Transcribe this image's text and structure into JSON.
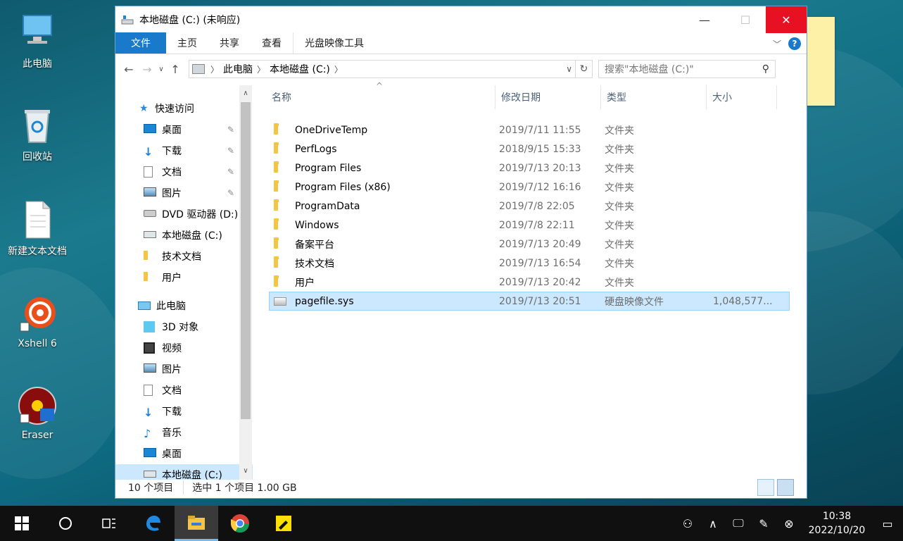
{
  "desktop": {
    "icons": [
      {
        "label": "此电脑",
        "icon": "computer-icon"
      },
      {
        "label": "回收站",
        "icon": "recycle-bin-icon"
      },
      {
        "label": "新建文本文档",
        "icon": "text-document-icon"
      },
      {
        "label": "Xshell 6",
        "icon": "xshell-icon"
      },
      {
        "label": "Eraser",
        "icon": "eraser-icon"
      }
    ]
  },
  "window": {
    "title": "本地磁盘 (C:) (未响应)",
    "ribbon_tabs": [
      "文件",
      "主页",
      "共享",
      "查看",
      "光盘映像工具"
    ],
    "breadcrumb": [
      "此电脑",
      "本地磁盘 (C:)"
    ],
    "search_placeholder": "搜索\"本地磁盘 (C:)\"",
    "nav": {
      "quick_access": "快速访问",
      "quick_items": [
        {
          "label": "桌面",
          "icon": "desktop-icon",
          "pinned": true
        },
        {
          "label": "下载",
          "icon": "download-icon",
          "pinned": true
        },
        {
          "label": "文档",
          "icon": "document-icon",
          "pinned": true
        },
        {
          "label": "图片",
          "icon": "picture-icon",
          "pinned": true
        },
        {
          "label": "DVD 驱动器 (D:)",
          "icon": "dvd-drive-icon",
          "pinned": false
        },
        {
          "label": "本地磁盘 (C:)",
          "icon": "local-disk-icon",
          "pinned": false
        },
        {
          "label": "技术文档",
          "icon": "folder-icon",
          "pinned": false
        },
        {
          "label": "用户",
          "icon": "folder-icon",
          "pinned": false
        }
      ],
      "this_pc": "此电脑",
      "pc_items": [
        {
          "label": "3D 对象",
          "icon": "3d-objects-icon"
        },
        {
          "label": "视频",
          "icon": "video-icon"
        },
        {
          "label": "图片",
          "icon": "picture-icon"
        },
        {
          "label": "文档",
          "icon": "document-icon"
        },
        {
          "label": "下载",
          "icon": "download-icon"
        },
        {
          "label": "音乐",
          "icon": "music-icon"
        },
        {
          "label": "桌面",
          "icon": "desktop-icon"
        },
        {
          "label": "本地磁盘 (C:)",
          "icon": "local-disk-icon"
        }
      ]
    },
    "columns": [
      "名称",
      "修改日期",
      "类型",
      "大小"
    ],
    "files": [
      {
        "name": "OneDriveTemp",
        "date": "2019/7/11 11:55",
        "type": "文件夹",
        "size": "",
        "kind": "folder"
      },
      {
        "name": "PerfLogs",
        "date": "2018/9/15 15:33",
        "type": "文件夹",
        "size": "",
        "kind": "folder"
      },
      {
        "name": "Program Files",
        "date": "2019/7/13 20:13",
        "type": "文件夹",
        "size": "",
        "kind": "folder"
      },
      {
        "name": "Program Files (x86)",
        "date": "2019/7/12 16:16",
        "type": "文件夹",
        "size": "",
        "kind": "folder"
      },
      {
        "name": "ProgramData",
        "date": "2019/7/8 22:05",
        "type": "文件夹",
        "size": "",
        "kind": "folder-narrow"
      },
      {
        "name": "Windows",
        "date": "2019/7/8 22:11",
        "type": "文件夹",
        "size": "",
        "kind": "folder"
      },
      {
        "name": "备案平台",
        "date": "2019/7/13 20:49",
        "type": "文件夹",
        "size": "",
        "kind": "folder"
      },
      {
        "name": "技术文档",
        "date": "2019/7/13 16:54",
        "type": "文件夹",
        "size": "",
        "kind": "folder"
      },
      {
        "name": "用户",
        "date": "2019/7/13 20:42",
        "type": "文件夹",
        "size": "",
        "kind": "folder"
      },
      {
        "name": "pagefile.sys",
        "date": "2019/7/13 20:51",
        "type": "硬盘映像文件",
        "size": "1,048,577...",
        "kind": "sys",
        "selected": true
      }
    ],
    "status": {
      "count": "10 个项目",
      "selection": "选中 1 个项目  1.00 GB"
    }
  },
  "taskbar": {
    "apps": [
      "start-icon",
      "cortana-icon",
      "task-view-icon",
      "edge-icon",
      "file-explorer-icon",
      "chrome-icon",
      "sticky-notes-icon"
    ],
    "clock_time": "10:38",
    "clock_date": "2022/10/20"
  }
}
